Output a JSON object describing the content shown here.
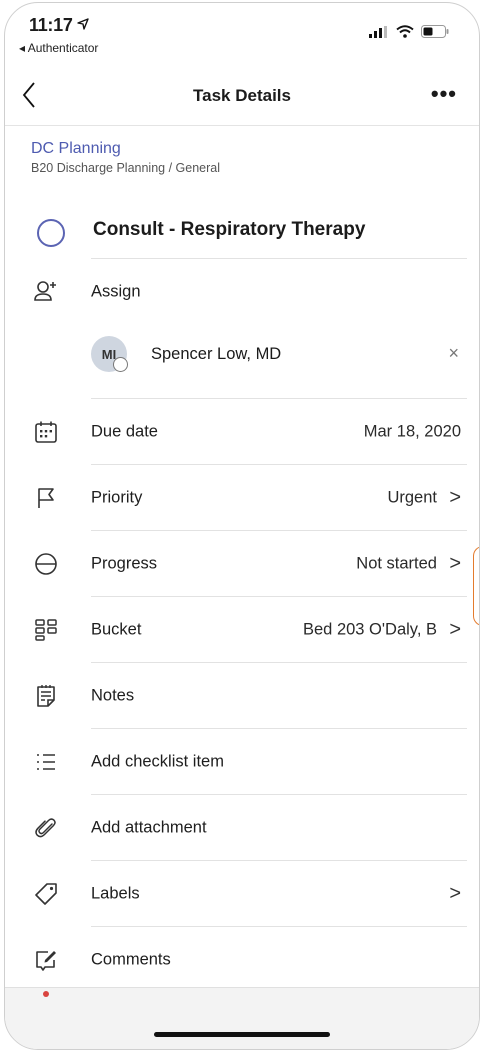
{
  "status_bar": {
    "time": "11:17",
    "back_app": "◂ Authenticator"
  },
  "nav": {
    "title": "Task Details",
    "more": "•••"
  },
  "plan": {
    "name": "DC Planning",
    "path": "B20 Discharge Planning / General"
  },
  "task": {
    "title": "Consult - Respiratory Therapy"
  },
  "assign": {
    "label": "Assign",
    "assignee_initials": "MI",
    "assignee_name": "Spencer Low, MD",
    "remove": "×"
  },
  "fields": {
    "due_date": {
      "label": "Due date",
      "value": "Mar 18, 2020"
    },
    "priority": {
      "label": "Priority",
      "value": "Urgent"
    },
    "progress": {
      "label": "Progress",
      "value": "Not started"
    },
    "bucket": {
      "label": "Bucket",
      "value": "Bed 203 O'Daly, B"
    },
    "notes": {
      "label": "Notes"
    },
    "checklist": {
      "label": "Add checklist item"
    },
    "attachment": {
      "label": "Add attachment"
    },
    "labels": {
      "label": "Labels"
    },
    "comments": {
      "label": "Comments"
    }
  },
  "chevron": ">",
  "colors": {
    "accent": "#4e5bb0",
    "annotation": "#e47b2d"
  }
}
